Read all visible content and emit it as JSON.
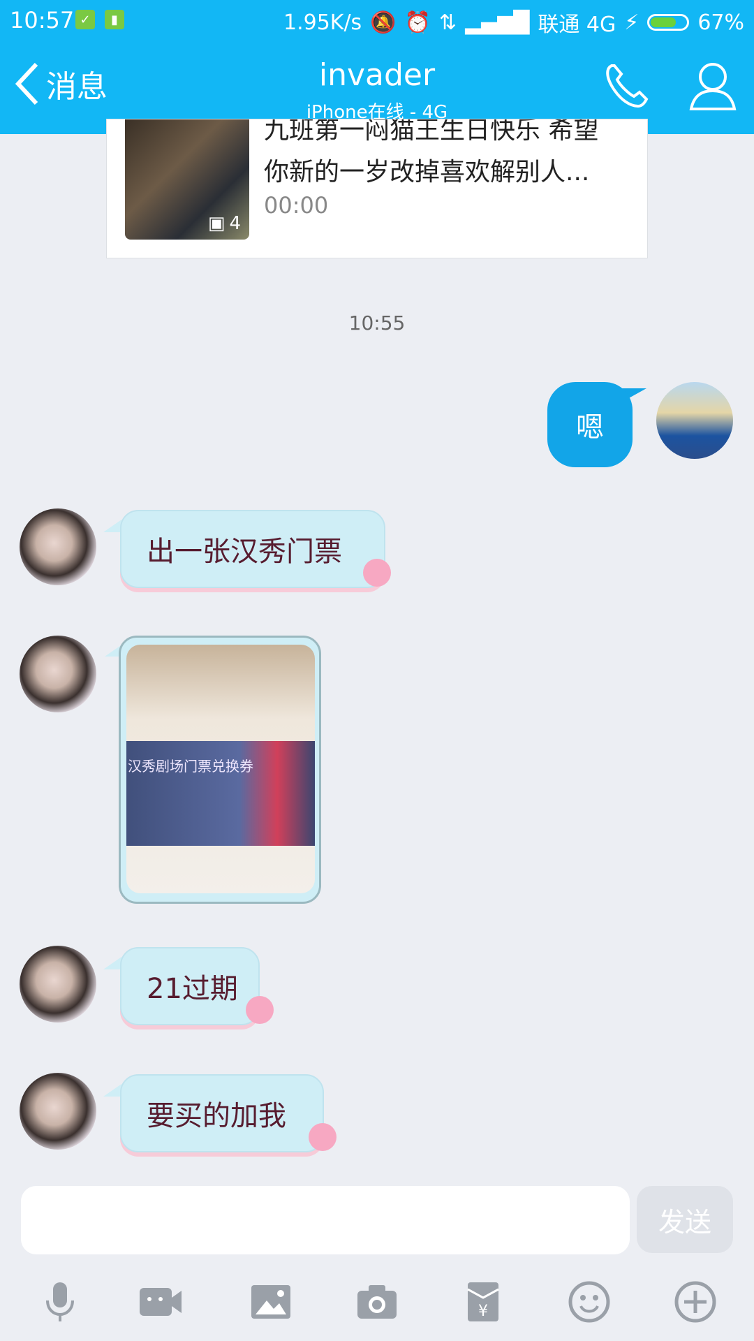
{
  "status_bar": {
    "time": "10:57",
    "net_speed": "1.95K/s",
    "carrier": "联通 4G",
    "battery": "67%",
    "battery_level": 0.67
  },
  "header": {
    "back_label": "消息",
    "title": "invader",
    "subtitle": "iPhone在线 - 4G"
  },
  "shared_card": {
    "title_line1": "九班第一闷猫王生日快乐 希望",
    "title_line2": "你新的一岁改掉喜欢解别人...",
    "duration": "00:00",
    "image_count": "4"
  },
  "messages": {
    "timestamp": "10:55",
    "items": [
      {
        "from": "me",
        "text": "嗯"
      },
      {
        "from": "other",
        "text": "出一张汉秀门票"
      },
      {
        "from": "other",
        "type": "image",
        "caption": "汉秀剧场门票兑换券"
      },
      {
        "from": "other",
        "text": "21过期"
      },
      {
        "from": "other",
        "text": "要买的加我"
      }
    ]
  },
  "input": {
    "placeholder": "",
    "send_label": "发送"
  },
  "toolbar": {
    "items": [
      "mic-icon",
      "video-icon",
      "image-icon",
      "camera-icon",
      "red-packet-icon",
      "emoji-icon",
      "plus-icon"
    ]
  },
  "colors": {
    "brand": "#12b7f5",
    "my_bubble": "#12a5e8",
    "other_bubble": "#cfeef6",
    "background": "#eceef3"
  }
}
